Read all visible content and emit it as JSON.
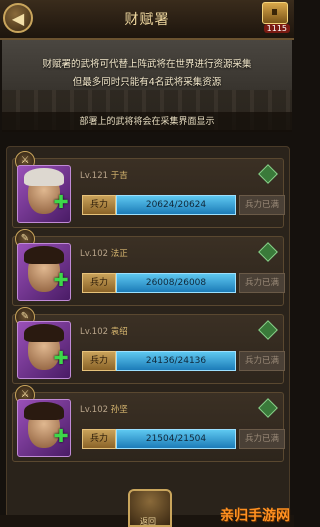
{
  "header": {
    "title": "财赋署",
    "count": "1115",
    "back_icon": "◀"
  },
  "banner": {
    "line1": "财赋署的武将可代替上阵武将在世界进行资源采集",
    "line2": "但最多同时只能有4名武将采集资源",
    "bottom": "部署上的武将将会在采集界面显示"
  },
  "generals": [
    {
      "level": "Lv.121",
      "name": "于吉",
      "troop_label": "兵力",
      "troops": "20624/20624",
      "status": "兵力已满",
      "hair": "white"
    },
    {
      "level": "Lv.102",
      "name": "法正",
      "troop_label": "兵力",
      "troops": "26008/26008",
      "status": "兵力已满",
      "hair": "dark"
    },
    {
      "level": "Lv.102",
      "name": "袁绍",
      "troop_label": "兵力",
      "troops": "24136/24136",
      "status": "兵力已满",
      "hair": "dark"
    },
    {
      "level": "Lv.102",
      "name": "孙坚",
      "troop_label": "兵力",
      "troops": "21504/21504",
      "status": "兵力已满",
      "hair": "dark"
    }
  ],
  "footer": {
    "back_label": "返回",
    "watermark": "亲归手游网"
  },
  "colors": {
    "accent": "#c9a55c",
    "troop_bar": "#1c7cb8",
    "portrait": "#9a50b8",
    "plus": "#3dd84a"
  }
}
